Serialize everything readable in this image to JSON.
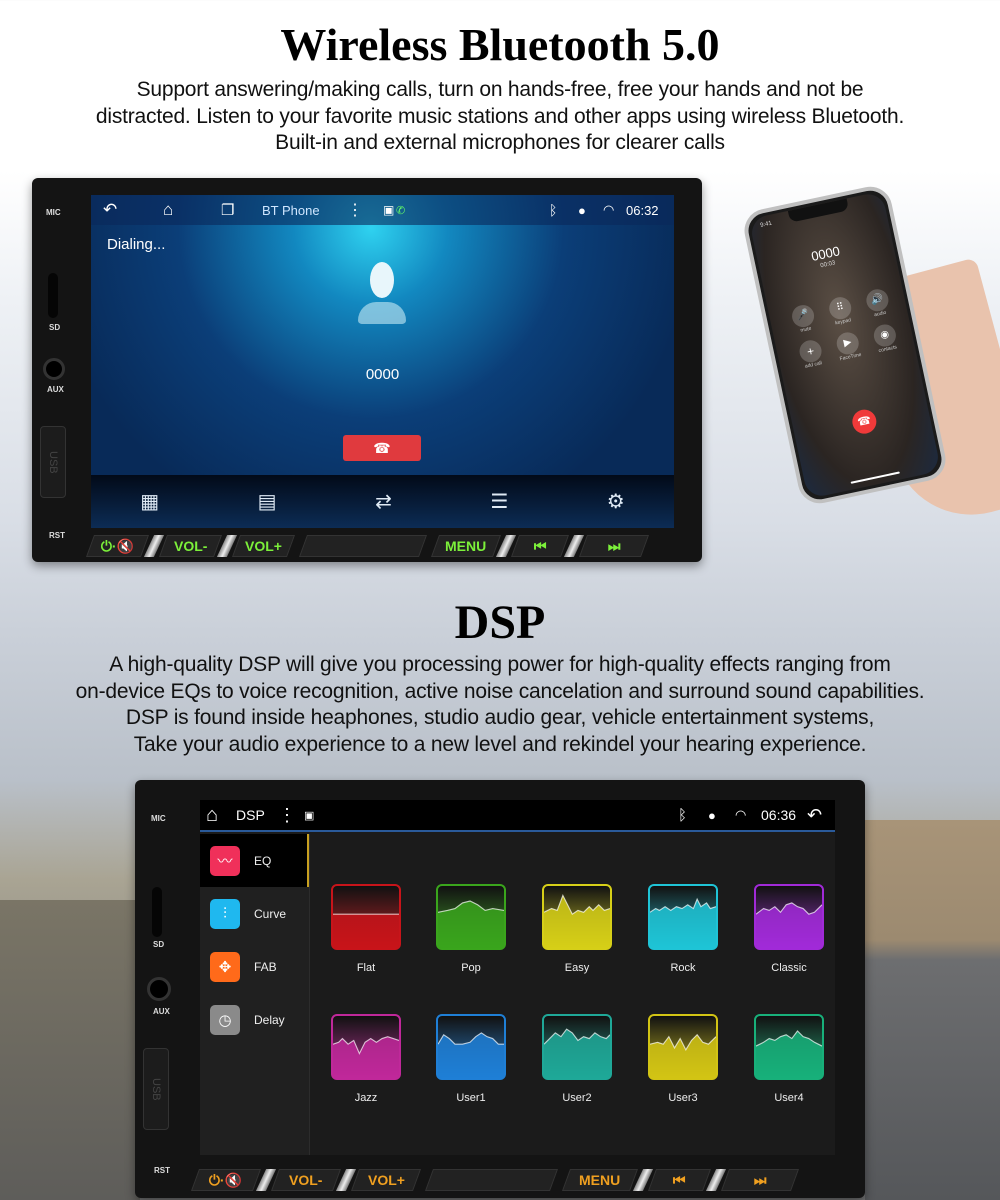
{
  "section1": {
    "title": "Wireless Bluetooth 5.0",
    "lines": [
      "Support answering/making calls, turn on hands-free, free your hands and not be",
      "distracted. Listen to your favorite music stations and other apps using wireless Bluetooth.",
      "Built-in and external microphones for clearer calls"
    ]
  },
  "device1": {
    "panel_labels": {
      "mic": "MIC",
      "sd": "SD",
      "aux": "AUX",
      "usb": "USB",
      "rst": "RST"
    },
    "status_bar": {
      "app": "BT Phone",
      "time": "06:32",
      "icons": [
        "back-icon",
        "home-icon",
        "recent-apps-icon",
        "more-icon",
        "gallery-icon",
        "phone-link-icon",
        "bluetooth-icon",
        "location-icon",
        "wifi-icon"
      ]
    },
    "call": {
      "status": "Dialing...",
      "number": "0000",
      "end_button_icon": "hang-up-icon"
    },
    "bottom_nav": [
      "dialpad-icon",
      "contacts-icon",
      "call-transfer-icon",
      "call-log-icon",
      "bluetooth-settings-icon"
    ],
    "hw_buttons": {
      "power": "⏻·🔇",
      "vol_down": "VOL-",
      "vol_up": "VOL+",
      "menu": "MENU",
      "prev": "⏮",
      "next": "⏭"
    },
    "button_color": "#7cf03a"
  },
  "phone": {
    "number": "0000",
    "timer": "00:03",
    "time": "9:41",
    "buttons": [
      "mute",
      "keypad",
      "audio",
      "add call",
      "FaceTime",
      "contacts"
    ]
  },
  "section2": {
    "title": "DSP",
    "lines": [
      "A high-quality DSP will give you processing power for high-quality effects ranging from",
      "on-device EQs to voice recognition, active noise cancelation and surround sound capabilities.",
      "DSP is found inside heaphones, studio audio gear, vehicle entertainment systems,",
      "Take your audio experience to a new level and rekindel your hearing experience."
    ]
  },
  "device2": {
    "panel_labels": {
      "mic": "MIC",
      "sd": "SD",
      "aux": "AUX",
      "usb": "USB",
      "rst": "RST"
    },
    "status_bar": {
      "app": "DSP",
      "time": "06:36"
    },
    "sidebar": [
      {
        "label": "EQ",
        "icon": "waveform-icon",
        "color": "#f0305a",
        "active": true
      },
      {
        "label": "Curve",
        "icon": "equalizer-sliders-icon",
        "color": "#1fb8ef",
        "active": false
      },
      {
        "label": "FAB",
        "icon": "fader-balance-icon",
        "color": "#ff6a1a",
        "active": false
      },
      {
        "label": "Delay",
        "icon": "clock-icon",
        "color": "#8a8a8a",
        "active": false
      }
    ],
    "presets": [
      {
        "label": "Flat",
        "color": "#c8141a"
      },
      {
        "label": "Pop",
        "color": "#3aa51c"
      },
      {
        "label": "Easy",
        "color": "#d6cf18"
      },
      {
        "label": "Rock",
        "color": "#1fc4d6"
      },
      {
        "label": "Classic",
        "color": "#a12ad8"
      },
      {
        "label": "Jazz",
        "color": "#c0289a"
      },
      {
        "label": "User1",
        "color": "#1f7fd6"
      },
      {
        "label": "User2",
        "color": "#1fa898"
      },
      {
        "label": "User3",
        "color": "#d2c414"
      },
      {
        "label": "User4",
        "color": "#18b07a"
      }
    ],
    "hw_buttons": {
      "power": "⏻·🔇",
      "vol_down": "VOL-",
      "vol_up": "VOL+",
      "menu": "MENU",
      "prev": "⏮",
      "next": "⏭"
    },
    "button_color": "#f0a020"
  }
}
